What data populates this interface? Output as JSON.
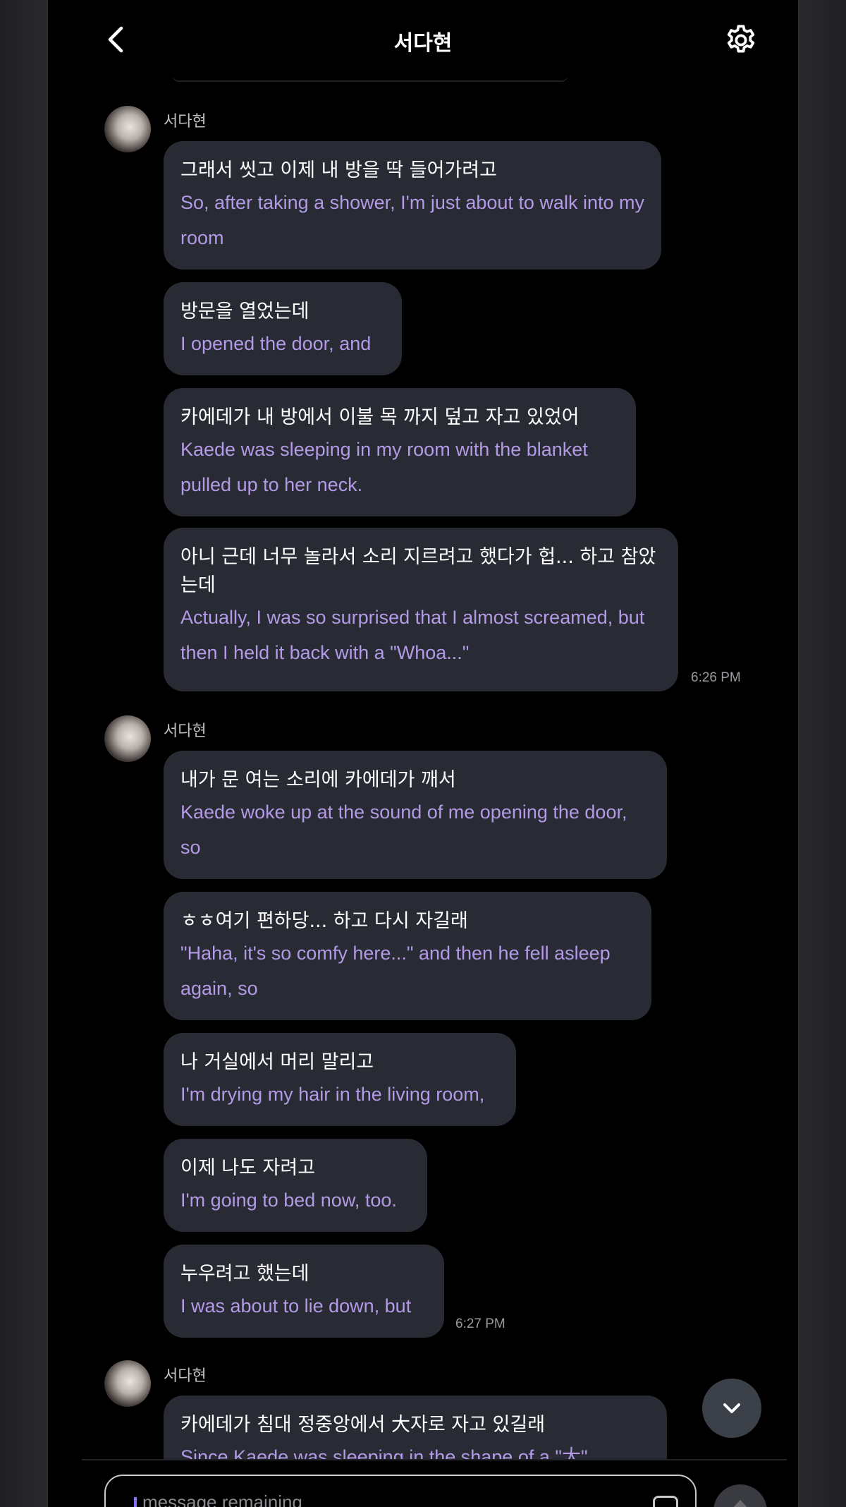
{
  "header": {
    "title": "서다현"
  },
  "groups": [
    {
      "sender": "서다현",
      "messages": [
        {
          "ko": "그래서 씻고 이제 내 방을 딱 들어가려고",
          "en": "So, after taking a shower, I'm just about to walk into my room"
        },
        {
          "ko": "방문을 열었는데",
          "en": "I opened the door, and"
        },
        {
          "ko": "카에데가 내 방에서 이불 목 까지 덮고 자고 있었어",
          "en": "Kaede was sleeping in my room with the blanket pulled up to her neck."
        },
        {
          "ko": "아니 근데 너무 놀라서 소리 지르려고 했다가 헙... 하고 참았는데",
          "en": "Actually, I was so surprised that I almost screamed, but then I held it back with a \"Whoa...\""
        }
      ],
      "time": "6:26 PM"
    },
    {
      "sender": "서다현",
      "messages": [
        {
          "ko": "내가 문 여는 소리에 카에데가 깨서",
          "en": "Kaede woke up at the sound of me opening the door, so"
        },
        {
          "ko": "ㅎㅎ여기 편하당... 하고 다시 자길래",
          "en": "\"Haha, it's so comfy here...\" and then he fell asleep again, so"
        },
        {
          "ko": "나 거실에서 머리 말리고",
          "en": "I'm drying my hair in the living room,"
        },
        {
          "ko": "이제 나도 자려고",
          "en": "I'm going to bed now, too."
        },
        {
          "ko": "누우려고 했는데",
          "en": "I was about to lie down, but"
        }
      ],
      "time": "6:27 PM"
    },
    {
      "sender": "서다현",
      "messages": [
        {
          "ko": "카에데가 침대 정중앙에서 大자로 자고 있길래",
          "en": "Since Kaede was sleeping in the shape of a \"大\""
        }
      ]
    }
  ],
  "composer": {
    "placeholder": "message remaining"
  },
  "icons": {
    "back": "chevron-left-icon",
    "settings": "gear-icon",
    "scroll": "chevron-down-icon",
    "send": "arrow-up-icon",
    "emoji": "sticker-icon"
  }
}
